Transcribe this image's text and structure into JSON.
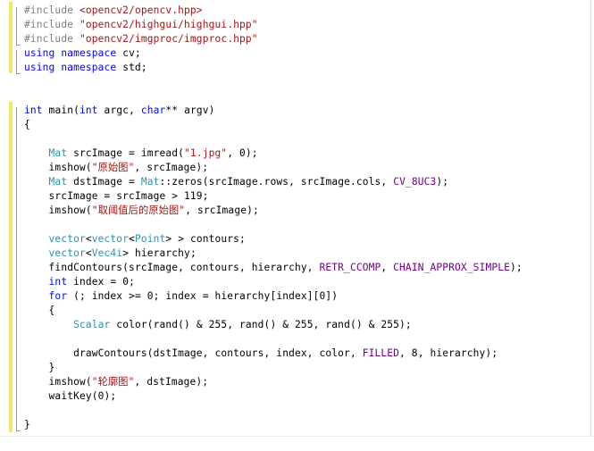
{
  "editor": {
    "colors": {
      "plain": "#000000",
      "keyword": "#0000ff",
      "type": "#2b91af",
      "string": "#a31515",
      "preprocessor": "#808080",
      "macro": "#6f008a",
      "changed_margin": "#f5e663"
    },
    "lines": [
      [
        {
          "t": "#include ",
          "c": "preprocessor"
        },
        {
          "t": "<opencv2/opencv.hpp>",
          "c": "string"
        }
      ],
      [
        {
          "t": "#include ",
          "c": "preprocessor"
        },
        {
          "t": "\"opencv2/highgui/highgui.hpp\"",
          "c": "string"
        }
      ],
      [
        {
          "t": "#include ",
          "c": "preprocessor"
        },
        {
          "t": "\"opencv2/imgproc/imgproc.hpp\"",
          "c": "string"
        }
      ],
      [
        {
          "t": "using",
          "c": "keyword"
        },
        {
          "t": " ",
          "c": "plain"
        },
        {
          "t": "namespace",
          "c": "keyword"
        },
        {
          "t": " cv;",
          "c": "plain"
        }
      ],
      [
        {
          "t": "using",
          "c": "keyword"
        },
        {
          "t": " ",
          "c": "plain"
        },
        {
          "t": "namespace",
          "c": "keyword"
        },
        {
          "t": " std;",
          "c": "plain"
        }
      ],
      [],
      [],
      [
        {
          "t": "int",
          "c": "keyword"
        },
        {
          "t": " main(",
          "c": "plain"
        },
        {
          "t": "int",
          "c": "keyword"
        },
        {
          "t": " argc, ",
          "c": "plain"
        },
        {
          "t": "char",
          "c": "keyword"
        },
        {
          "t": "** argv)",
          "c": "plain"
        }
      ],
      [
        {
          "t": "{",
          "c": "plain"
        }
      ],
      [],
      [
        {
          "t": "    ",
          "c": "plain"
        },
        {
          "t": "Mat",
          "c": "type"
        },
        {
          "t": " srcImage = imread(",
          "c": "plain"
        },
        {
          "t": "\"1.jpg\"",
          "c": "string"
        },
        {
          "t": ", 0);",
          "c": "plain"
        }
      ],
      [
        {
          "t": "    imshow(",
          "c": "plain"
        },
        {
          "t": "\"原始图\"",
          "c": "string"
        },
        {
          "t": ", srcImage);",
          "c": "plain"
        }
      ],
      [
        {
          "t": "    ",
          "c": "plain"
        },
        {
          "t": "Mat",
          "c": "type"
        },
        {
          "t": " dstImage = ",
          "c": "plain"
        },
        {
          "t": "Mat",
          "c": "type"
        },
        {
          "t": "::zeros(srcImage.rows, srcImage.cols, ",
          "c": "plain"
        },
        {
          "t": "CV_8UC3",
          "c": "macro"
        },
        {
          "t": ");",
          "c": "plain"
        }
      ],
      [
        {
          "t": "    srcImage = srcImage > 119;",
          "c": "plain"
        }
      ],
      [
        {
          "t": "    imshow(",
          "c": "plain"
        },
        {
          "t": "\"取阈值后的原始图\"",
          "c": "string"
        },
        {
          "t": ", srcImage);",
          "c": "plain"
        }
      ],
      [],
      [
        {
          "t": "    ",
          "c": "plain"
        },
        {
          "t": "vector",
          "c": "type"
        },
        {
          "t": "<",
          "c": "plain"
        },
        {
          "t": "vector",
          "c": "type"
        },
        {
          "t": "<",
          "c": "plain"
        },
        {
          "t": "Point",
          "c": "type"
        },
        {
          "t": "> > contours;",
          "c": "plain"
        }
      ],
      [
        {
          "t": "    ",
          "c": "plain"
        },
        {
          "t": "vector",
          "c": "type"
        },
        {
          "t": "<",
          "c": "plain"
        },
        {
          "t": "Vec4i",
          "c": "type"
        },
        {
          "t": "> hierarchy;",
          "c": "plain"
        }
      ],
      [
        {
          "t": "    findContours(srcImage, contours, hierarchy, ",
          "c": "plain"
        },
        {
          "t": "RETR_CCOMP",
          "c": "macro"
        },
        {
          "t": ", ",
          "c": "plain"
        },
        {
          "t": "CHAIN_APPROX_SIMPLE",
          "c": "macro"
        },
        {
          "t": ");",
          "c": "plain"
        }
      ],
      [
        {
          "t": "    ",
          "c": "plain"
        },
        {
          "t": "int",
          "c": "keyword"
        },
        {
          "t": " index = 0;",
          "c": "plain"
        }
      ],
      [
        {
          "t": "    ",
          "c": "plain"
        },
        {
          "t": "for",
          "c": "keyword"
        },
        {
          "t": " (; index >= 0; index = hierarchy[index][0])",
          "c": "plain"
        }
      ],
      [
        {
          "t": "    {",
          "c": "plain"
        }
      ],
      [
        {
          "t": "        ",
          "c": "plain"
        },
        {
          "t": "Scalar",
          "c": "type"
        },
        {
          "t": " color(rand() & 255, rand() & 255, rand() & 255);",
          "c": "plain"
        }
      ],
      [],
      [
        {
          "t": "        drawContours(dstImage, contours, index, color, ",
          "c": "plain"
        },
        {
          "t": "FILLED",
          "c": "macro"
        },
        {
          "t": ", 8, hierarchy);",
          "c": "plain"
        }
      ],
      [
        {
          "t": "    }",
          "c": "plain"
        }
      ],
      [
        {
          "t": "    imshow(",
          "c": "plain"
        },
        {
          "t": "\"轮廓图\"",
          "c": "string"
        },
        {
          "t": ", dstImage);",
          "c": "plain"
        }
      ],
      [
        {
          "t": "    waitKey(0);",
          "c": "plain"
        }
      ],
      [],
      [
        {
          "t": "}",
          "c": "plain"
        }
      ]
    ]
  }
}
